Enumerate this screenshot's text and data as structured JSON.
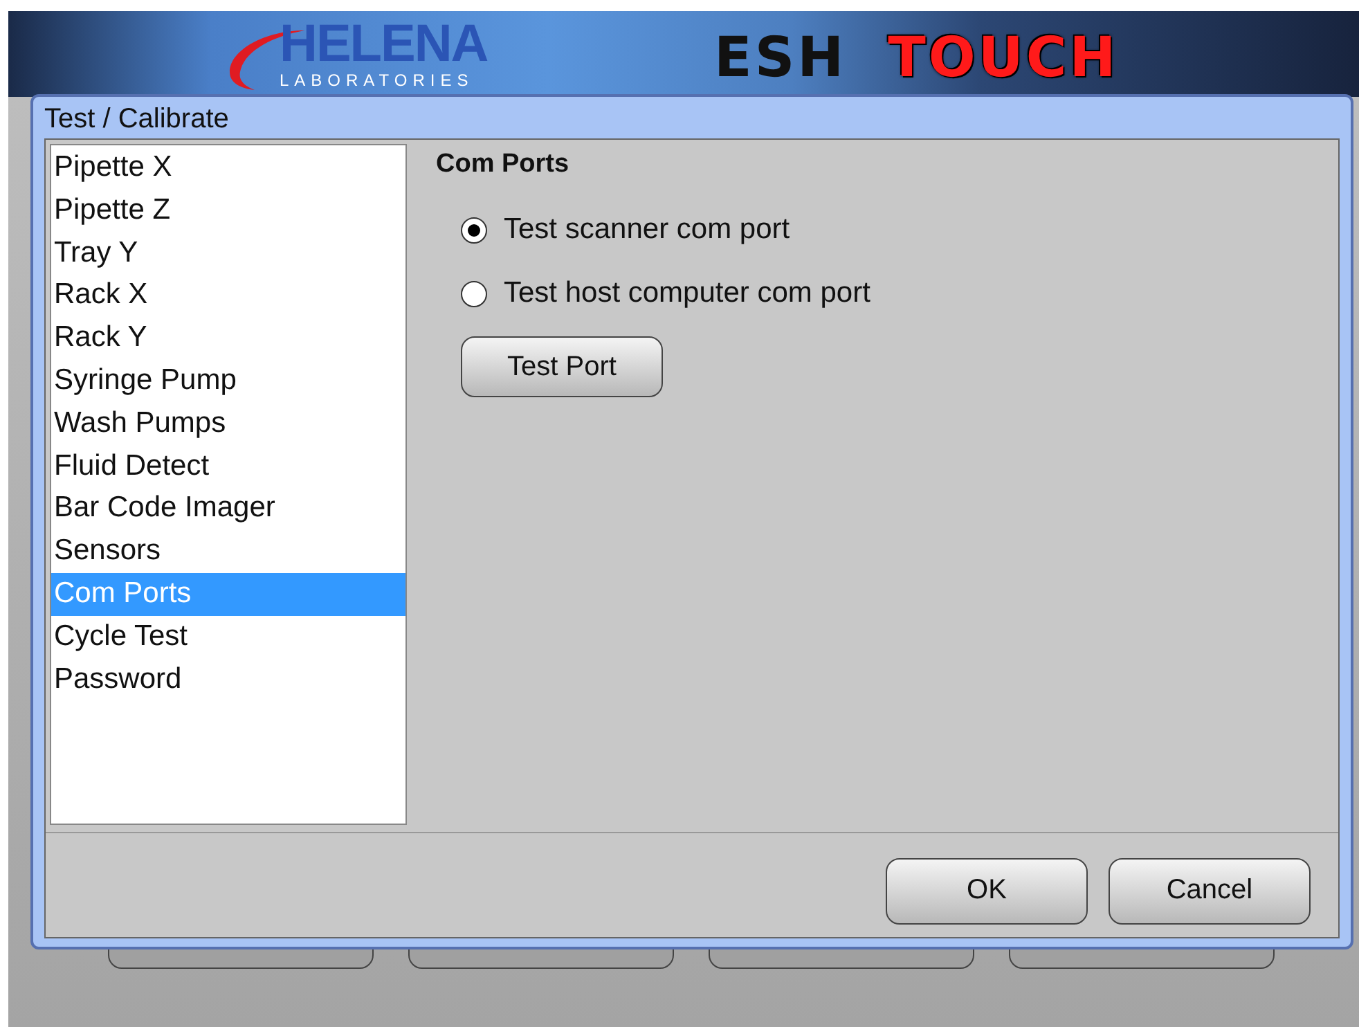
{
  "header": {
    "brand": "HELENA",
    "brand_sub": "LABORATORIES",
    "product": "ESH",
    "product_accent": "TOUCH"
  },
  "dialog": {
    "title": "Test / Calibrate",
    "items": [
      {
        "label": "Pipette X",
        "selected": false
      },
      {
        "label": "Pipette Z",
        "selected": false
      },
      {
        "label": "Tray Y",
        "selected": false
      },
      {
        "label": "Rack X",
        "selected": false
      },
      {
        "label": "Rack Y",
        "selected": false
      },
      {
        "label": "Syringe Pump",
        "selected": false
      },
      {
        "label": "Wash Pumps",
        "selected": false
      },
      {
        "label": "Fluid Detect",
        "selected": false
      },
      {
        "label": "Bar Code Imager",
        "selected": false
      },
      {
        "label": "Sensors",
        "selected": false
      },
      {
        "label": "Com Ports",
        "selected": true
      },
      {
        "label": "Cycle Test",
        "selected": false
      },
      {
        "label": "Password",
        "selected": false
      }
    ],
    "panel": {
      "heading": "Com Ports",
      "options": [
        {
          "label": "Test scanner com port",
          "selected": true
        },
        {
          "label": "Test host computer com port",
          "selected": false
        }
      ],
      "button": "Test Port"
    },
    "buttons": [
      "OK",
      "Cancel"
    ]
  }
}
